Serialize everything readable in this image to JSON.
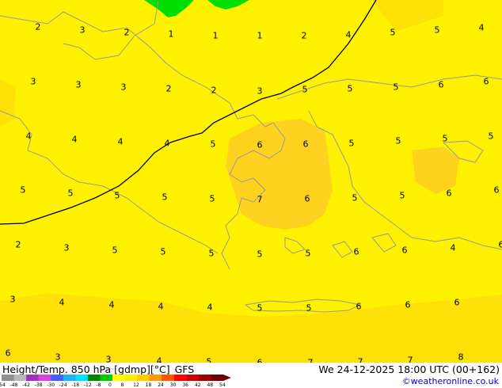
{
  "map": {
    "background_color": "#fff200",
    "warm_color": "#ffd21f",
    "mid_color": "#ffe10a",
    "cold_color": "#00dd00",
    "contour_color": "#000000",
    "coast_color": "#9a9a9a",
    "labels": [
      "2",
      "3",
      "2",
      "1",
      "1",
      "1",
      "2",
      "4",
      "5",
      "5",
      "4",
      "3",
      "3",
      "3",
      "2",
      "2",
      "3",
      "5",
      "5",
      "5",
      "6",
      "6",
      "4",
      "4",
      "4",
      "4",
      "5",
      "6",
      "6",
      "5",
      "5",
      "5",
      "5",
      "5",
      "5",
      "5",
      "5",
      "5",
      "7",
      "6",
      "5",
      "5",
      "6",
      "6",
      "2",
      "3",
      "5",
      "5",
      "5",
      "5",
      "5",
      "6",
      "6",
      "4",
      "6",
      "3",
      "4",
      "4",
      "4",
      "4",
      "5",
      "5",
      "6",
      "6",
      "6",
      "6",
      "3",
      "3",
      "4",
      "5",
      "6",
      "7",
      "7",
      "7",
      "8"
    ]
  },
  "footer": {
    "title": "Height/Temp. 850 hPa [gdmp][°C]",
    "model": "GFS",
    "datetime": "We 24-12-2025 18:00 UTC (00+162)",
    "credit": "©weatheronline.co.uk",
    "colorbar": {
      "labels": [
        "-54",
        "-48",
        "-42",
        "-38",
        "-30",
        "-24",
        "-18",
        "-12",
        "-8",
        "0",
        "8",
        "12",
        "18",
        "24",
        "30",
        "36",
        "42",
        "48",
        "54"
      ],
      "colors": [
        "#909090",
        "#b8b8b8",
        "#a030c0",
        "#e040e0",
        "#4060ff",
        "#20b0ff",
        "#00e0ff",
        "#008800",
        "#00cc00",
        "#ffff00",
        "#ffea00",
        "#ffcc00",
        "#ff9900",
        "#ff5500",
        "#ff0000",
        "#d00000",
        "#a00000",
        "#700000"
      ]
    }
  }
}
